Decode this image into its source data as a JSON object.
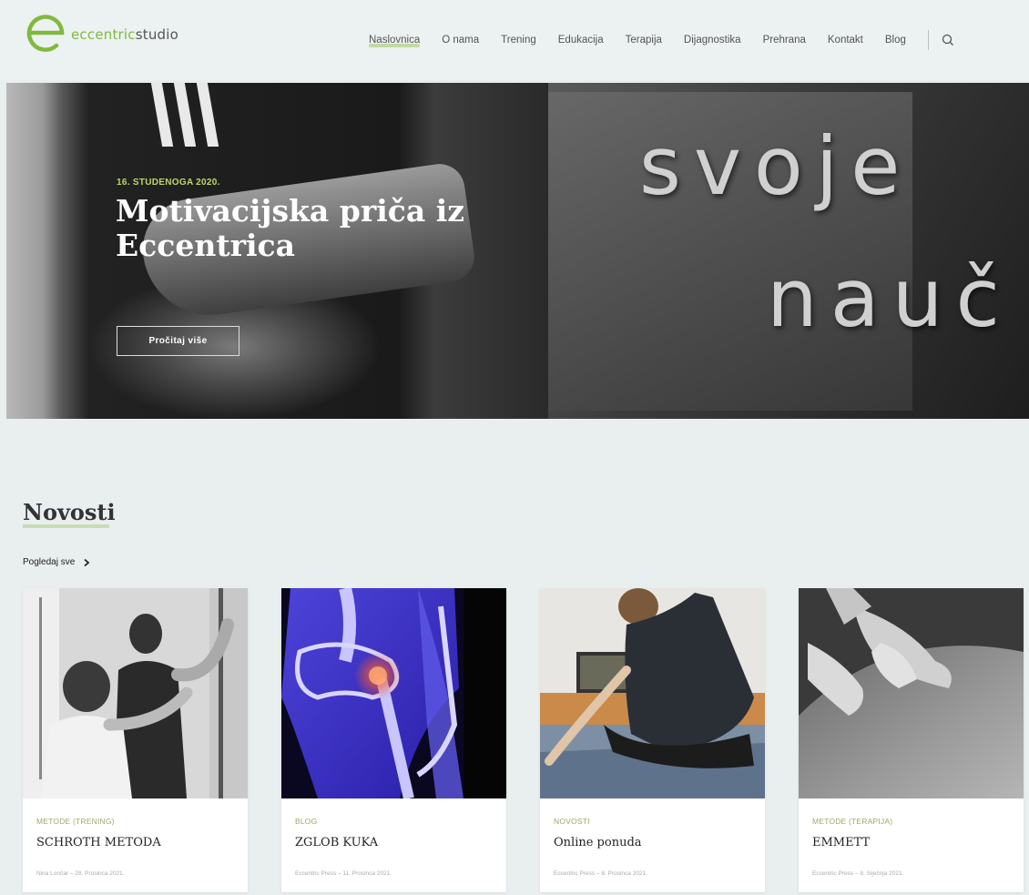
{
  "header": {
    "logo_prefix": "eccentric",
    "logo_suffix": "studio",
    "nav": [
      "Naslovnica",
      "O nama",
      "Trening",
      "Edukacija",
      "Terapija",
      "Dijagnostika",
      "Prehrana",
      "Kontakt",
      "Blog"
    ],
    "active_nav": "Naslovnica"
  },
  "hero": {
    "date": "16. STUDENOGA 2020.",
    "title": "Motivacijska priča iz Eccentrica",
    "button": "Pročitaj više",
    "bg_text_line1": "svoje",
    "bg_text_line2": "nauč"
  },
  "news": {
    "title": "Novosti",
    "see_all": "Pogledaj sve",
    "cards": [
      {
        "category": "METODE (TRENING)",
        "title": "SCHROTH METODA",
        "meta": "Nina Lončar – 28. Prosinca 2021."
      },
      {
        "category": "BLOG",
        "title": "ZGLOB KUKA",
        "meta": "Eccentric Press – 11. Prosinca 2021."
      },
      {
        "category": "NOVOSTI",
        "title": "Online ponuda",
        "meta": "Eccentric Press – 8. Prosinca 2021."
      },
      {
        "category": "METODE (TERAPIJA)",
        "title": "EMMETT",
        "meta": "Eccentric Press – 8. Siječnja 2021."
      }
    ]
  },
  "colors": {
    "accent": "#7fba3f",
    "page_bg": "#e9eeee"
  }
}
